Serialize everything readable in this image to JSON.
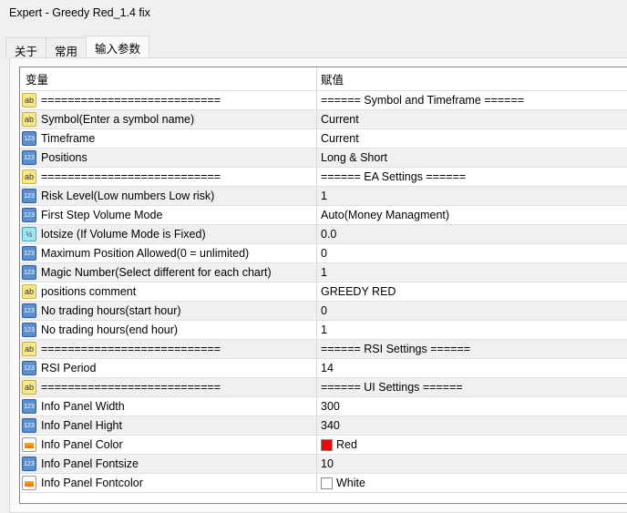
{
  "window": {
    "title": "Expert - Greedy Red_1.4 fix"
  },
  "tabs": [
    {
      "label": "关于"
    },
    {
      "label": "常用"
    },
    {
      "label": "输入参数",
      "active": true
    }
  ],
  "table": {
    "headers": {
      "variable": "变量",
      "value": "赋值"
    },
    "rows": [
      {
        "icon": "ab",
        "name": "===========================",
        "value": "======  Symbol and Timeframe  ======"
      },
      {
        "icon": "ab",
        "name": "Symbol(Enter a symbol name)",
        "value": "Current"
      },
      {
        "icon": "123",
        "name": "Timeframe",
        "value": "Current"
      },
      {
        "icon": "123",
        "name": "Positions",
        "value": "Long & Short"
      },
      {
        "icon": "ab",
        "name": "===========================",
        "value": "======  EA Settings  ======"
      },
      {
        "icon": "123",
        "name": "Risk Level(Low numbers Low risk)",
        "value": "1"
      },
      {
        "icon": "123",
        "name": "First Step Volume Mode",
        "value": "Auto(Money Managment)"
      },
      {
        "icon": "half",
        "name": "lotsize (If Volume Mode is Fixed)",
        "value": "0.0"
      },
      {
        "icon": "123",
        "name": "Maximum Position Allowed(0 = unlimited)",
        "value": "0"
      },
      {
        "icon": "123",
        "name": "Magic Number(Select different for each chart)",
        "value": "1"
      },
      {
        "icon": "ab",
        "name": "positions  comment",
        "value": "GREEDY RED"
      },
      {
        "icon": "123",
        "name": "No trading hours(start hour)",
        "value": "0"
      },
      {
        "icon": "123",
        "name": "No trading hours(end hour)",
        "value": "1"
      },
      {
        "icon": "ab",
        "name": "===========================",
        "value": "======  RSI Settings  ======"
      },
      {
        "icon": "123",
        "name": "RSI Period",
        "value": "14"
      },
      {
        "icon": "ab",
        "name": "===========================",
        "value": "======  UI Settings  ======"
      },
      {
        "icon": "123",
        "name": "Info Panel Width",
        "value": "300"
      },
      {
        "icon": "123",
        "name": "Info Panel Hight",
        "value": "340"
      },
      {
        "icon": "color",
        "name": "Info Panel Color",
        "value": "Red",
        "swatch": "#ff0000"
      },
      {
        "icon": "123",
        "name": "Info Panel Fontsize",
        "value": "10"
      },
      {
        "icon": "color",
        "name": "Info Panel Fontcolor",
        "value": "White",
        "swatch": "#ffffff"
      }
    ]
  },
  "icons": {
    "ab": "ab",
    "123": "123",
    "half": "½"
  }
}
